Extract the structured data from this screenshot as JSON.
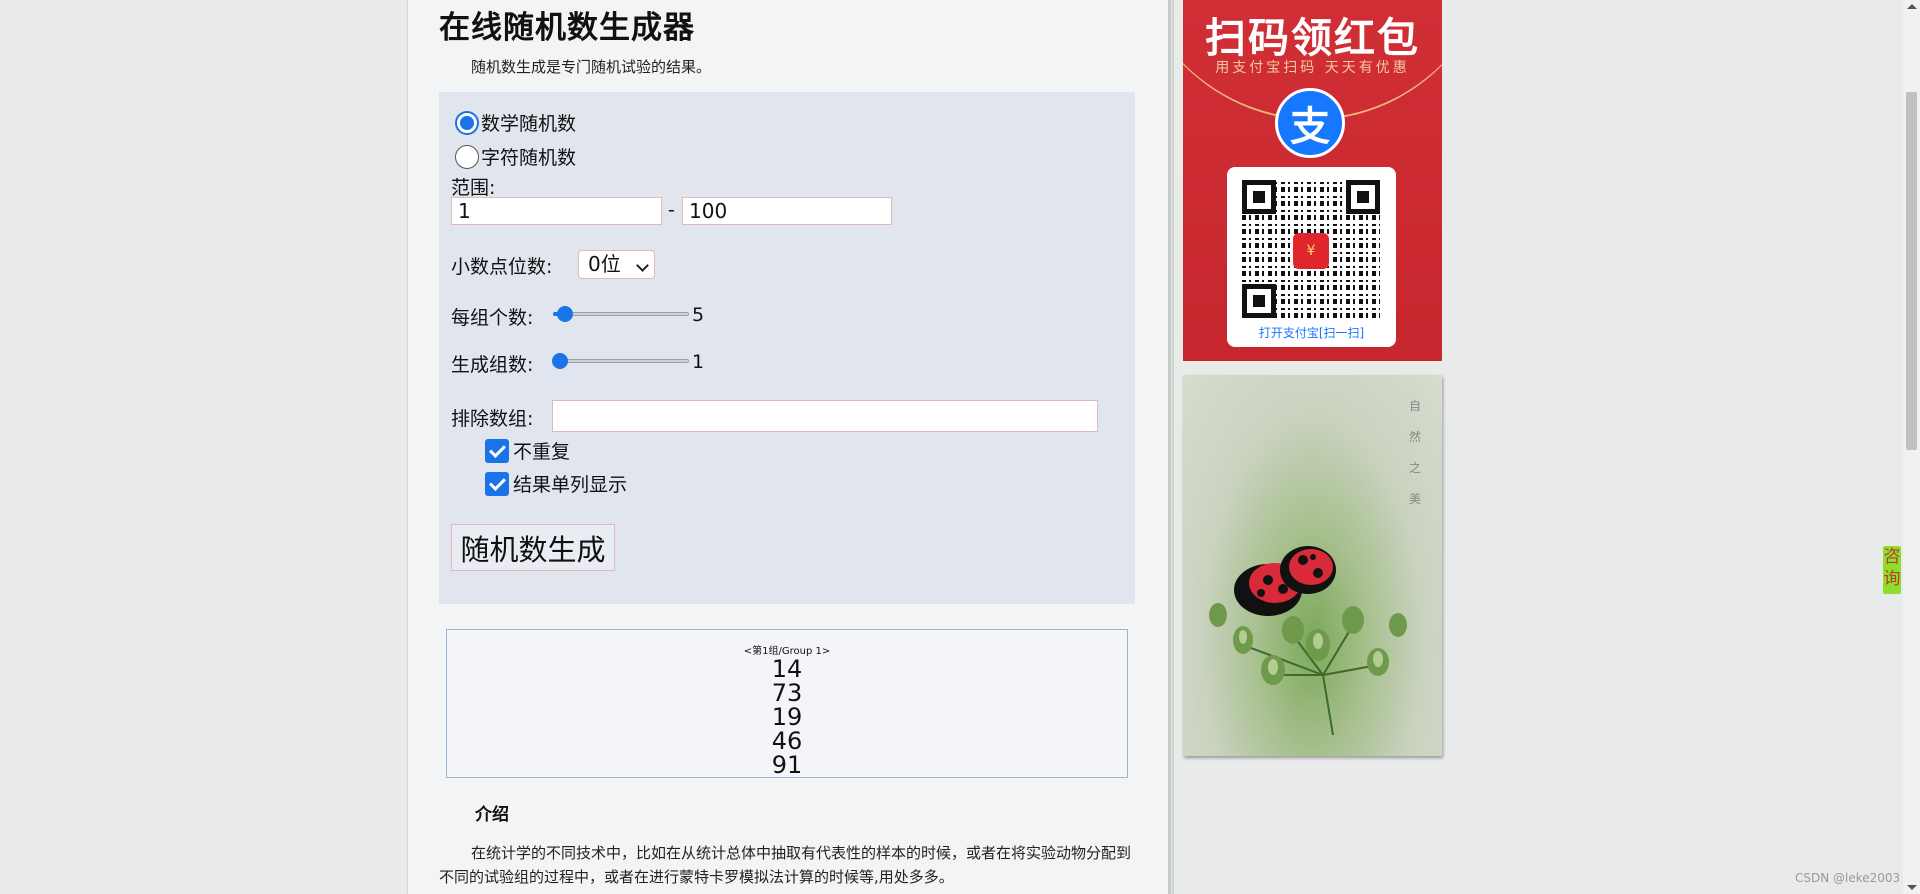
{
  "page": {
    "title": "在线随机数生成器",
    "subtitle": "随机数生成是专门随机试验的结果。"
  },
  "form": {
    "radio_math": "数学随机数",
    "radio_string": "字符随机数",
    "range_label": "范围:",
    "range_min": "1",
    "range_sep": "-",
    "range_max": "100",
    "decimal_label": "小数点位数:",
    "decimal_value": "0位",
    "per_group_label": "每组个数:",
    "per_group_value": "5",
    "per_group_fraction": 0.09,
    "group_count_label": "生成组数:",
    "group_count_value": "1",
    "group_count_fraction": 0.05,
    "exclude_label": "排除数组:",
    "exclude_value": "",
    "no_repeat_label": "不重复",
    "single_column_label": "结果单列显示",
    "generate_button": "随机数生成"
  },
  "result": {
    "group_label": "<第1组/Group 1>",
    "numbers": [
      "14",
      "73",
      "19",
      "46",
      "91"
    ]
  },
  "intro": {
    "title": "介绍",
    "text": "在统计学的不同技术中，比如在从统计总体中抽取有代表性的样本的时候，或者在将实验动物分配到不同的试验组的过程中，或者在进行蒙特卡罗模拟法计算的时候等,用处多多。"
  },
  "ads": {
    "red_title": "扫码领红包",
    "red_sub": "用支付宝扫码 天天有优惠",
    "logo_char": "支",
    "qr_center_char": "¥",
    "qr_caption": "打开支付宝[扫一扫]",
    "photo_caption": "自然之美"
  },
  "side": {
    "consult": "咨询"
  },
  "watermark": "CSDN @leke2003",
  "colors": {
    "accent": "#1a73e8",
    "ad_red": "#c6262d",
    "consult_green": "#8ce02c"
  }
}
